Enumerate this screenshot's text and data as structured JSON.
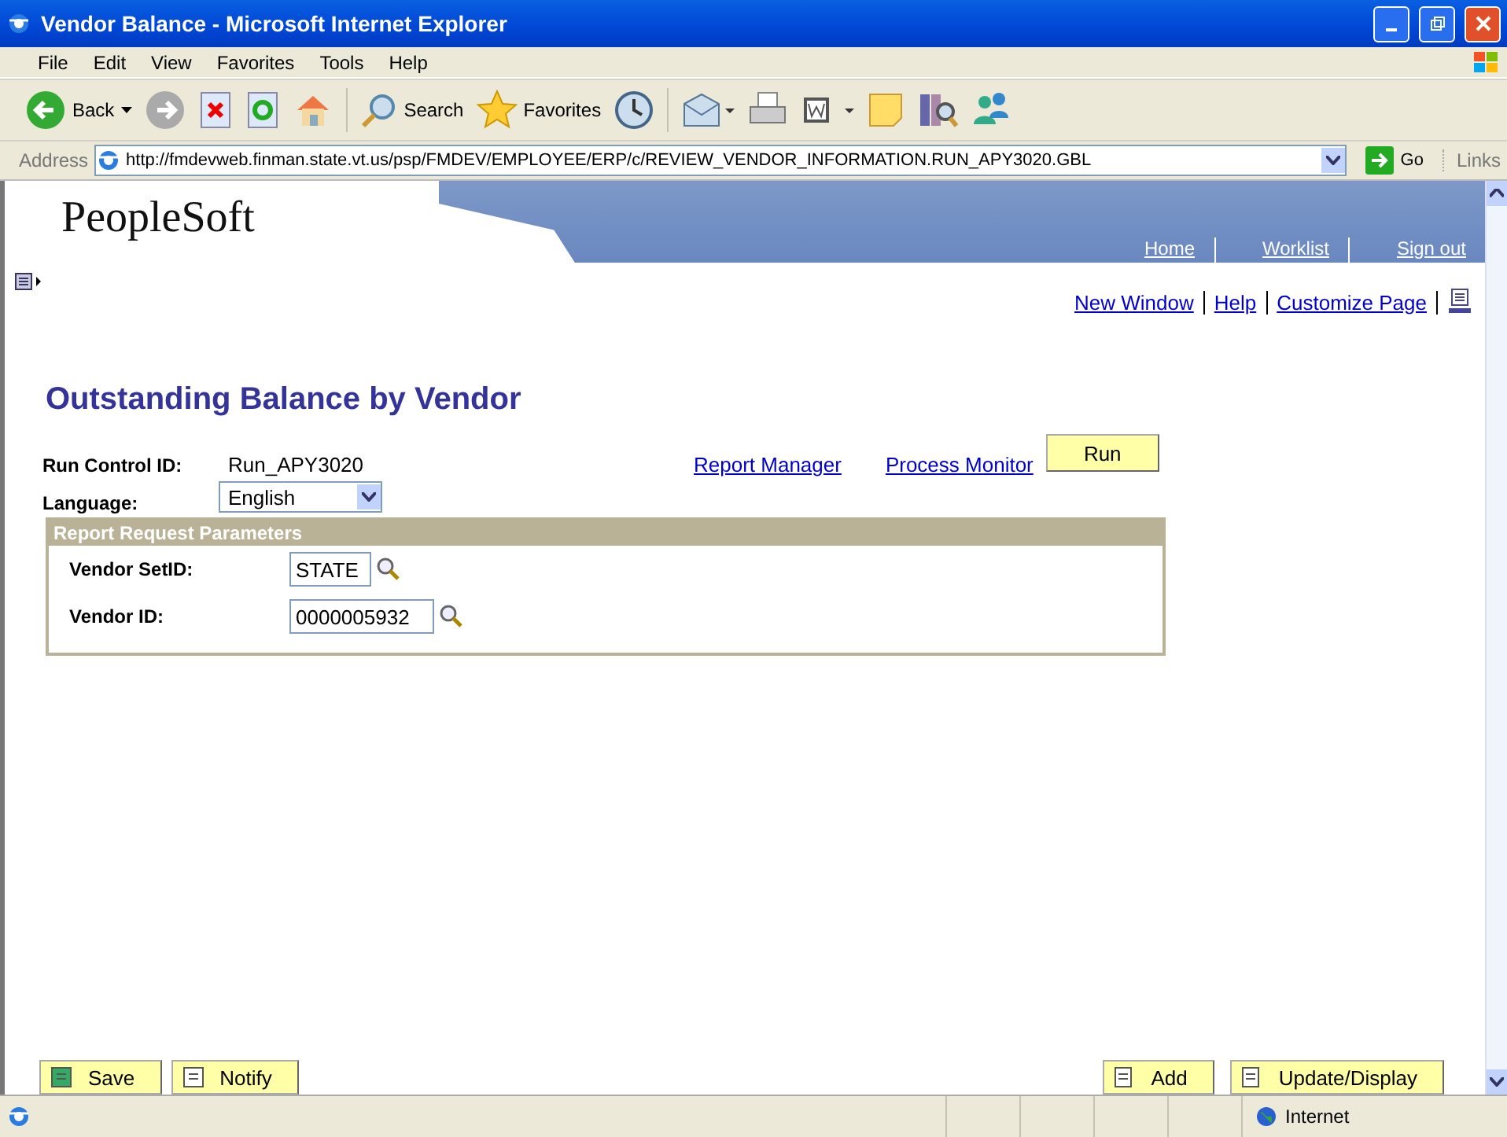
{
  "window": {
    "title": "Vendor Balance - Microsoft Internet Explorer"
  },
  "menu": [
    "File",
    "Edit",
    "View",
    "Favorites",
    "Tools",
    "Help"
  ],
  "toolbar": {
    "back": "Back",
    "search": "Search",
    "favorites": "Favorites"
  },
  "address_bar": {
    "label": "Address",
    "url": "http://fmdevweb.finman.state.vt.us/psp/FMDEV/EMPLOYEE/ERP/c/REVIEW_VENDOR_INFORMATION.RUN_APY3020.GBL",
    "go": "Go",
    "links": "Links"
  },
  "header": {
    "logo": "PeopleSoft",
    "nav": [
      "Home",
      "Worklist",
      "Sign out"
    ]
  },
  "page_links": [
    "New Window",
    "Help",
    "Customize Page"
  ],
  "page": {
    "title": "Outstanding Balance by Vendor",
    "run_control": {
      "label": "Run Control ID:",
      "value": "Run_APY3020"
    },
    "language": {
      "label": "Language:",
      "value": "English"
    },
    "links": [
      "Report Manager",
      "Process Monitor"
    ],
    "run_button": "Run",
    "group": {
      "title": "Report Request Parameters",
      "fields": [
        {
          "label": "Vendor SetID:",
          "value": "STATE"
        },
        {
          "label": "Vendor ID:",
          "value": "0000005932"
        }
      ]
    }
  },
  "bottom_buttons": {
    "left": [
      "Save",
      "Notify"
    ],
    "right": [
      "Add",
      "Update/Display"
    ]
  },
  "status_bar": {
    "zone": "Internet"
  }
}
